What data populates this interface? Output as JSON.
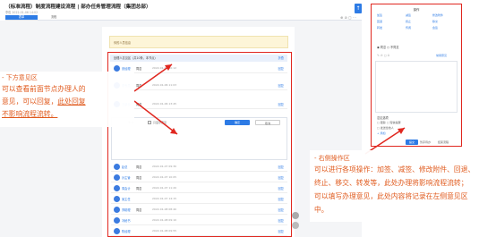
{
  "header": {
    "title": "（标准流程）制度流程建设流程 | 部办任务管理流程（集团总部）",
    "meta": "李俊   2022-01-06 14:02",
    "tabs": [
      "表单",
      "流程"
    ],
    "toolbar_icons": "⊕  ⊘  ◻  ⋯"
  },
  "document": {
    "notice": "你的人员信息",
    "panel_title": "处理人意见区（共10条，本节点）",
    "panel_action": "折叠",
    "rows_top": [
      {
        "name": "张经理",
        "op": "同意",
        "time": "2022-01-06 10:12",
        "reply": "回复"
      },
      {
        "name": "李专员",
        "op": "同意",
        "time": "2022-01-06 11:03",
        "reply": "回复"
      },
      {
        "name": "王部长",
        "op": "同意",
        "time": "2022-01-06 13:45",
        "reply": "回复"
      }
    ],
    "rows_bottom": [
      {
        "name": "赵总",
        "op": "同意",
        "time": "2022-01-07 09:30",
        "reply": "回复"
      },
      {
        "name": "孙主管",
        "op": "同意",
        "time": "2022-01-07 10:05",
        "reply": "回复"
      },
      {
        "name": "周会计",
        "op": "同意",
        "time": "2022-01-07 11:20",
        "reply": "回复"
      },
      {
        "name": "吴主任",
        "op": "",
        "time": "2022-01-07 14:15",
        "reply": "回复"
      },
      {
        "name": "郑助理",
        "op": "同意",
        "time": "2022-01-08 08:40",
        "reply": "回复"
      },
      {
        "name": "冯秘书",
        "op": "",
        "time": "2022-01-08 09:10",
        "reply": "回复"
      },
      {
        "name": "陈经理",
        "op": "",
        "time": "2022-01-08 09:55",
        "reply": "回复"
      }
    ],
    "editor": {
      "tools": "✎  ⊘",
      "checkbox_label": "只显示意见",
      "ok": "确定",
      "cancel": "取消"
    }
  },
  "right_panel": {
    "title": "操作",
    "actions": [
      "加签",
      "减签",
      "修改附件",
      "回退",
      "终止",
      "移交",
      "转发",
      "传阅",
      "会签"
    ],
    "radio": "◉ 同意   ○ 不同意",
    "tools": "✎   ⊘   ◻   A",
    "tools_link": "常用意见",
    "options_title": "意见选项",
    "option_a": "□ 跟踪   □ 短信提醒",
    "option_b": "□ 发送给他人",
    "option_c": "+ 添加",
    "submit": "提交",
    "save": "暂存待办",
    "end": "结束流程"
  },
  "callout_left": {
    "heading": "- 下方意见区",
    "line1": "可以查看前面节点办理人的",
    "line2": "意见，可以回复，",
    "line2_link": "此处回复",
    "line3": "不影响流程流转。"
  },
  "callout_right": {
    "heading": "- 右侧操作区",
    "line1": "可以进行各项操作：加签、减签、修改附件、回退、",
    "line2": "终止、移交、转发等，此处办理将影响流程流转；",
    "line3": "可以填写办理意见，此处内容将记录在左侧意见区",
    "line4": "中。"
  },
  "colors": {
    "accent": "#2d7be5",
    "highlight": "#e0271f",
    "callout": "#e05a1d"
  },
  "icons": {
    "pin": "pin-icon",
    "avatar": "avatar"
  }
}
